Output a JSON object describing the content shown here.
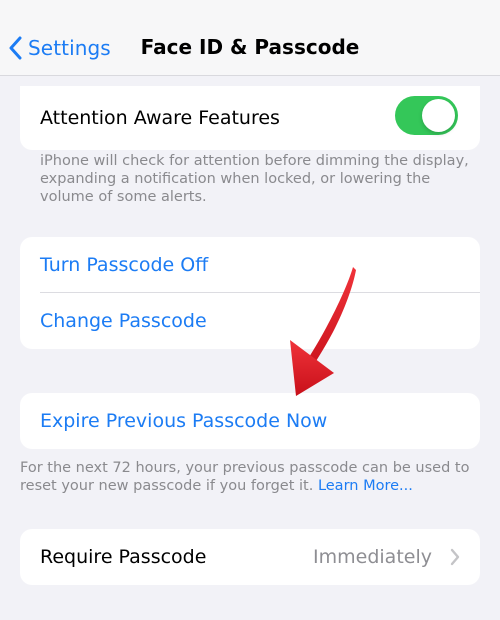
{
  "nav": {
    "back_label": "Settings",
    "title": "Face ID & Passcode"
  },
  "attention": {
    "label": "Attention Aware Features",
    "toggle_on": true,
    "footer": "iPhone will check for attention before dimming the display, expanding a notification when locked, or lowering the volume of some alerts."
  },
  "passcode": {
    "turn_off_label": "Turn Passcode Off",
    "change_label": "Change Passcode"
  },
  "expire": {
    "label": "Expire Previous Passcode Now",
    "footer": "For the next 72 hours, your previous passcode can be used to reset your new passcode if you forget it.",
    "learn_more": "Learn More..."
  },
  "require": {
    "label": "Require Passcode",
    "value": "Immediately"
  },
  "colors": {
    "accent": "#1c7cf4",
    "toggle_on": "#34c759",
    "annotation_arrow": "#e0161f"
  },
  "icons": {
    "back": "chevron-left-icon",
    "disclosure": "chevron-right-icon"
  }
}
